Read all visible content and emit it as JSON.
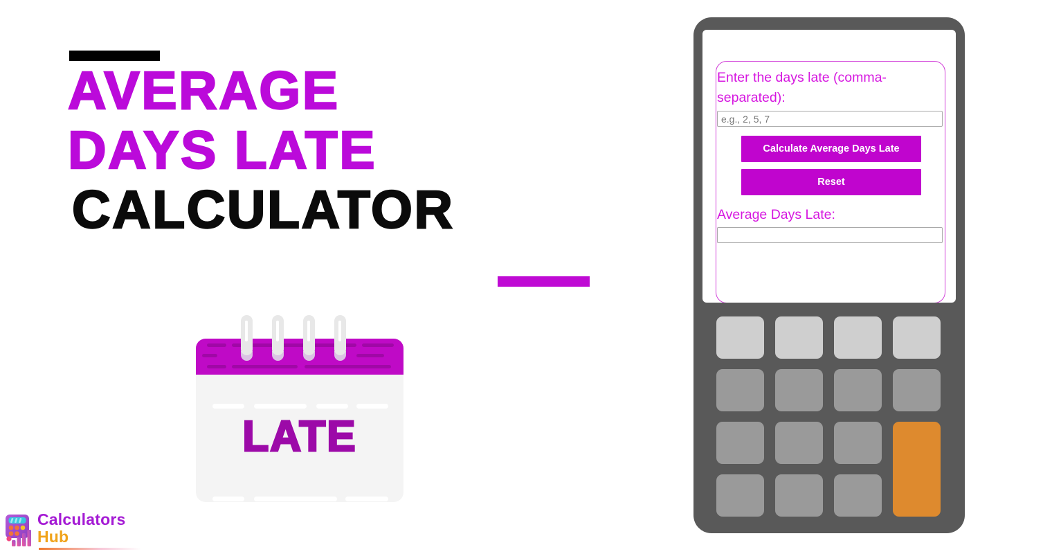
{
  "promo": {
    "title_lines": [
      "AVERAGE",
      "DAYS LATE",
      "CALCULATOR"
    ],
    "accent_color": "#bb0ada",
    "title_black_color": "#0b0b0b",
    "top_rule_color": "#000000",
    "bottom_rule_color": "#bf0ad4"
  },
  "calendar": {
    "word": "LATE",
    "header_color": "#bf0ac6",
    "body_color": "#f4f4f4",
    "word_color": "#9c0aa8"
  },
  "logo": {
    "line1": "Calculators",
    "line2": "Hub",
    "line1_color": "#a41ad4",
    "line2_color": "#f0a31a"
  },
  "calculator": {
    "input_label": "Enter the days late (comma-separated):",
    "input_value": "",
    "input_placeholder": "e.g., 2, 5, 7",
    "calculate_label": "Calculate Average Days Late",
    "reset_label": "Reset",
    "result_label": "Average Days Late:",
    "result_value": "",
    "result_placeholder": "",
    "button_color": "#c005ce",
    "label_color": "#d617e0",
    "body_color": "#595959",
    "key_color": "#9a9a9a",
    "key_light_color": "#cfcfcf",
    "key_accent_color": "#de8a2e",
    "keys": [
      {
        "id": "key-1",
        "style": "light"
      },
      {
        "id": "key-2",
        "style": "light"
      },
      {
        "id": "key-3",
        "style": "light"
      },
      {
        "id": "key-4",
        "style": "light"
      },
      {
        "id": "key-5",
        "style": "normal"
      },
      {
        "id": "key-6",
        "style": "normal"
      },
      {
        "id": "key-7",
        "style": "normal"
      },
      {
        "id": "key-8",
        "style": "normal"
      },
      {
        "id": "key-9",
        "style": "normal"
      },
      {
        "id": "key-10",
        "style": "normal"
      },
      {
        "id": "key-11",
        "style": "normal"
      },
      {
        "id": "key-equals",
        "style": "accent"
      },
      {
        "id": "key-12",
        "style": "normal"
      },
      {
        "id": "key-13",
        "style": "normal"
      },
      {
        "id": "key-14",
        "style": "normal"
      }
    ]
  }
}
